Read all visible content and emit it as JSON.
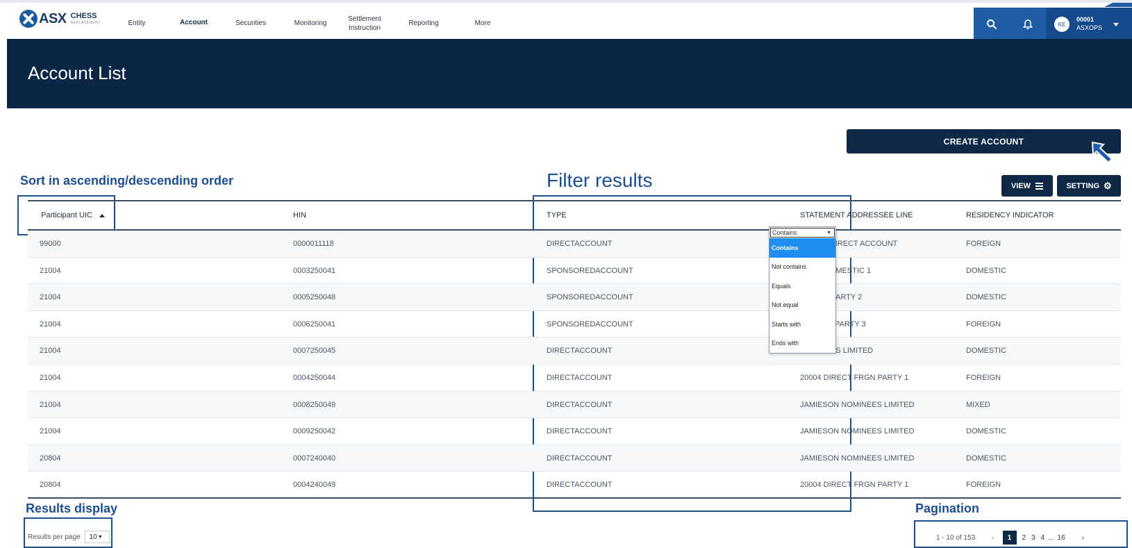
{
  "app": {
    "logo_text": "ASX",
    "logo_line1": "CHESS",
    "logo_line2": "REPLACEMENT"
  },
  "nav": [
    {
      "label": "Entity"
    },
    {
      "label": "Account",
      "active": true
    },
    {
      "label": "Securities"
    },
    {
      "label": "Monitoring"
    },
    {
      "label": "Settlement Instruction"
    },
    {
      "label": "Reporting"
    },
    {
      "label": "More"
    }
  ],
  "user": {
    "initials": "KE",
    "code": "00001",
    "name": "ASXOPS"
  },
  "page": {
    "title": "Account List",
    "create_label": "CREATE ACCOUNT"
  },
  "annotations": {
    "sort": "Sort in ascending/descending order",
    "filter": "Filter results",
    "results": "Results display",
    "pagination": "Pagination"
  },
  "toolbar": {
    "view_label": "VIEW",
    "setting_label": "SETTING"
  },
  "table": {
    "headers": [
      "Participant UIC",
      "HIN",
      "TYPE",
      "STATEMENT ADDRESSEE LINE",
      "RESIDENCY INDICATOR"
    ],
    "rows": [
      [
        "99000",
        "0000011118",
        "DIRECTACCOUNT",
        "ONDER DIRECT ACCOUNT",
        "FOREIGN"
      ],
      [
        "21004",
        "0003250041",
        "SPONSOREDACCOUNT",
        "NSOR DOMESTIC 1",
        "DOMESTIC"
      ],
      [
        "21004",
        "0005250048",
        "SPONSOREDACCOUNT",
        "MESTIC PARTY 2",
        "DOMESTIC"
      ],
      [
        "21004",
        "0006250041",
        "SPONSOREDACCOUNT",
        "NSORED PARTY 3",
        "FOREIGN"
      ],
      [
        "21004",
        "0007250045",
        "DIRECTACCOUNT",
        "NOMINEES LIMITED",
        "DOMESTIC"
      ],
      [
        "21004",
        "0004250044",
        "DIRECTACCOUNT",
        "20004 DIRECT FRGN PARTY 1",
        "FOREIGN"
      ],
      [
        "21004",
        "0008250049",
        "DIRECTACCOUNT",
        "JAMIESON NOMINEES LIMITED",
        "MIXED"
      ],
      [
        "21004",
        "0009250042",
        "DIRECTACCOUNT",
        "JAMIESON NOMINEES LIMITED",
        "DOMESTIC"
      ],
      [
        "20804",
        "0007240040",
        "DIRECTACCOUNT",
        "JAMIESON NOMINEES LIMITED",
        "DOMESTIC"
      ],
      [
        "20804",
        "0004240049",
        "DIRECTACCOUNT",
        "20004 DIRECT FRGN PARTY 1",
        "FOREIGN"
      ]
    ]
  },
  "filter": {
    "selected": "Contains",
    "options": [
      "Contains",
      "Not contains",
      "Equals",
      "Not equal",
      "Starts with",
      "Ends with"
    ]
  },
  "footer": {
    "rpp_label": "Results per page",
    "rpp_value": "10",
    "range": "1 - 10 of 153",
    "pages": [
      "1",
      "2",
      "3",
      "4",
      "...",
      "16"
    ],
    "prev": "‹",
    "next": "›"
  }
}
